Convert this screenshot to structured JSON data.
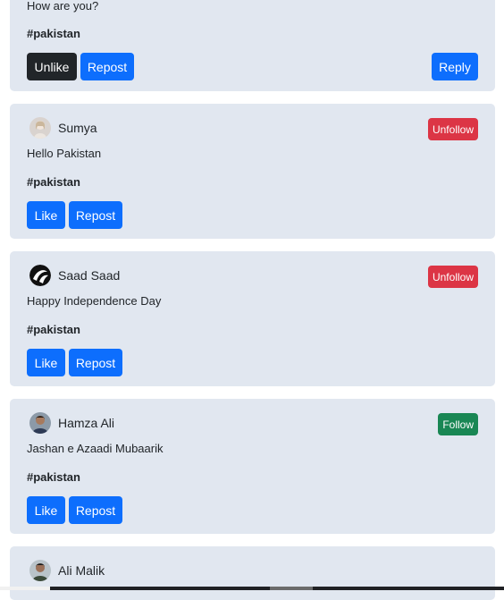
{
  "posts": [
    {
      "content": "How are you?",
      "hashtag": "#pakistan",
      "like_label": "Unlike",
      "repost_label": "Repost",
      "reply_label": "Reply"
    },
    {
      "username": "Sumya",
      "content": "Hello Pakistan",
      "hashtag": "#pakistan",
      "follow_label": "Unfollow",
      "like_label": "Like",
      "repost_label": "Repost"
    },
    {
      "username": "Saad Saad",
      "content": "Happy Independence Day",
      "hashtag": "#pakistan",
      "follow_label": "Unfollow",
      "like_label": "Like",
      "repost_label": "Repost"
    },
    {
      "username": "Hamza Ali",
      "content": "Jashan e Azaadi Mubaarik",
      "hashtag": "#pakistan",
      "follow_label": "Follow",
      "like_label": "Like",
      "repost_label": "Repost"
    },
    {
      "username": "Ali Malik"
    }
  ],
  "colors": {
    "card_bg": "#e1e7f0",
    "primary": "#0d6efd",
    "dark": "#212529",
    "danger": "#dc3545",
    "success": "#198754"
  },
  "icons": {
    "avatar": "avatar-icon"
  }
}
